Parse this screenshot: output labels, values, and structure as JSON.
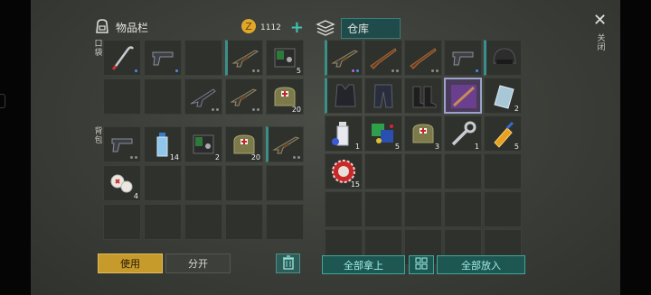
{
  "inventory": {
    "title": "物品栏",
    "coins": "1112",
    "add_symbol": "+",
    "pocket_label": "口袋",
    "backpack_label": "背包",
    "pocket_items": [
      {
        "icon": "crowbar-icon",
        "count": "",
        "dots": [
          "b"
        ]
      },
      {
        "icon": "pistol-icon",
        "count": "",
        "dots": [
          "b"
        ]
      },
      {
        "icon": "",
        "count": "",
        "dots": []
      },
      {
        "icon": "rifle-icon",
        "count": "",
        "dots": [
          "g",
          "g"
        ]
      },
      {
        "icon": "radio-icon",
        "count": "5",
        "dots": []
      },
      {
        "icon": "",
        "count": "",
        "dots": []
      },
      {
        "icon": "",
        "count": "",
        "dots": []
      },
      {
        "icon": "assault-rifle-icon",
        "count": "",
        "dots": [
          "g",
          "g"
        ]
      },
      {
        "icon": "rifle-icon",
        "count": "",
        "dots": [
          "g",
          "g"
        ]
      },
      {
        "icon": "medkit-icon",
        "count": "20",
        "dots": []
      }
    ],
    "backpack_items": [
      {
        "icon": "pistol-icon",
        "count": "",
        "dots": [
          "g",
          "g"
        ]
      },
      {
        "icon": "water-bottle-icon",
        "count": "14",
        "dots": []
      },
      {
        "icon": "radio-icon",
        "count": "2",
        "dots": []
      },
      {
        "icon": "medkit-icon",
        "count": "20",
        "dots": []
      },
      {
        "icon": "rifle-icon",
        "count": "",
        "dots": [
          "g",
          "g"
        ]
      },
      {
        "icon": "bandage-icon",
        "count": "4",
        "dots": []
      },
      {
        "icon": "",
        "count": "",
        "dots": []
      },
      {
        "icon": "",
        "count": "",
        "dots": []
      },
      {
        "icon": "",
        "count": "",
        "dots": []
      },
      {
        "icon": "",
        "count": "",
        "dots": []
      },
      {
        "icon": "",
        "count": "",
        "dots": []
      },
      {
        "icon": "",
        "count": "",
        "dots": []
      },
      {
        "icon": "",
        "count": "",
        "dots": []
      },
      {
        "icon": "",
        "count": "",
        "dots": []
      },
      {
        "icon": "",
        "count": "",
        "dots": []
      }
    ],
    "use_label": "使用",
    "split_label": "分开"
  },
  "warehouse": {
    "title": "仓库",
    "items": [
      {
        "icon": "rifle-icon",
        "count": "",
        "dots": [
          "p",
          "b"
        ]
      },
      {
        "icon": "shotgun-icon",
        "count": "",
        "dots": [
          "g",
          "g"
        ]
      },
      {
        "icon": "shotgun-icon",
        "count": "",
        "dots": [
          "g",
          "g"
        ]
      },
      {
        "icon": "pistol-icon",
        "count": "",
        "dots": [
          "b"
        ]
      },
      {
        "icon": "helmet-icon",
        "count": "",
        "dots": []
      },
      {
        "icon": "armor-vest-icon",
        "count": "",
        "dots": []
      },
      {
        "icon": "pants-icon",
        "count": "",
        "dots": []
      },
      {
        "icon": "boots-icon",
        "count": "",
        "dots": []
      },
      {
        "icon": "blueprint-icon",
        "count": "",
        "dots": []
      },
      {
        "icon": "glass-icon",
        "count": "2",
        "dots": []
      },
      {
        "icon": "spray-can-icon",
        "count": "1",
        "dots": []
      },
      {
        "icon": "crafting-parts-icon",
        "count": "5",
        "dots": []
      },
      {
        "icon": "medkit-icon",
        "count": "3",
        "dots": []
      },
      {
        "icon": "wrench-icon",
        "count": "1",
        "dots": []
      },
      {
        "icon": "glue-icon",
        "count": "5",
        "dots": []
      },
      {
        "icon": "bottle-cap-icon",
        "count": "15",
        "dots": []
      },
      {
        "icon": "",
        "count": "",
        "dots": []
      },
      {
        "icon": "",
        "count": "",
        "dots": []
      },
      {
        "icon": "",
        "count": "",
        "dots": []
      },
      {
        "icon": "",
        "count": "",
        "dots": []
      },
      {
        "icon": "",
        "count": "",
        "dots": []
      },
      {
        "icon": "",
        "count": "",
        "dots": []
      },
      {
        "icon": "",
        "count": "",
        "dots": []
      },
      {
        "icon": "",
        "count": "",
        "dots": []
      },
      {
        "icon": "",
        "count": "",
        "dots": []
      },
      {
        "icon": "",
        "count": "",
        "dots": []
      },
      {
        "icon": "",
        "count": "",
        "dots": []
      },
      {
        "icon": "",
        "count": "",
        "dots": []
      },
      {
        "icon": "",
        "count": "",
        "dots": []
      },
      {
        "icon": "",
        "count": "",
        "dots": []
      }
    ],
    "take_all_label": "全部拿上",
    "put_all_label": "全部放入"
  },
  "close_label": "关闭",
  "close_symbol": "✕",
  "colors": {
    "accent": "#3fa79c",
    "use_button": "#c79a2c",
    "coin": "#e0a82a",
    "selected": "#9aa2c8"
  }
}
